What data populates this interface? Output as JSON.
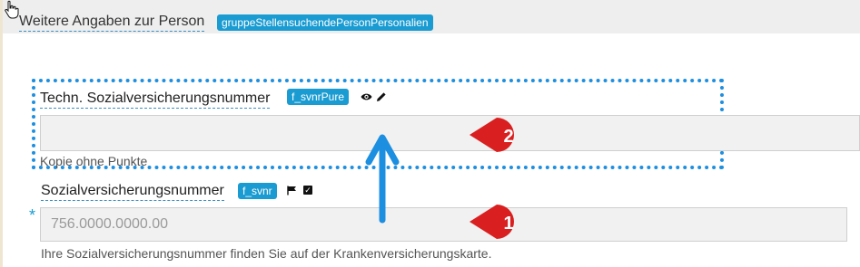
{
  "header": {
    "section_title": "Weitere Angaben zur Person",
    "group_tag": "gruppeStellensuchendePersonPersonalien"
  },
  "fields": {
    "techn": {
      "label": "Techn. Sozialversicherungsnummer",
      "tag": "f_svnrPure",
      "value": "",
      "hint": "Kopie ohne Punkte"
    },
    "svnr": {
      "label": "Sozialversicherungsnummer",
      "tag": "f_svnr",
      "required_mark": "*",
      "placeholder": "756.0000.0000.00",
      "hint": "Ihre Sozialversicherungsnummer finden Sie auf der Krankenversicherungskarte."
    }
  },
  "annotations": {
    "marker_1": "1",
    "marker_2": "2"
  },
  "icons": [
    "hand-cursor-icon",
    "eye-icon",
    "pencil-icon",
    "flag-icon",
    "checkbox-icon",
    "arrow-up-icon"
  ],
  "colors": {
    "tag_bg": "#1a9bd1",
    "highlight_border": "#1d8fe0",
    "marker_red": "#d91f1f",
    "arrow_blue": "#1d8fe0"
  }
}
